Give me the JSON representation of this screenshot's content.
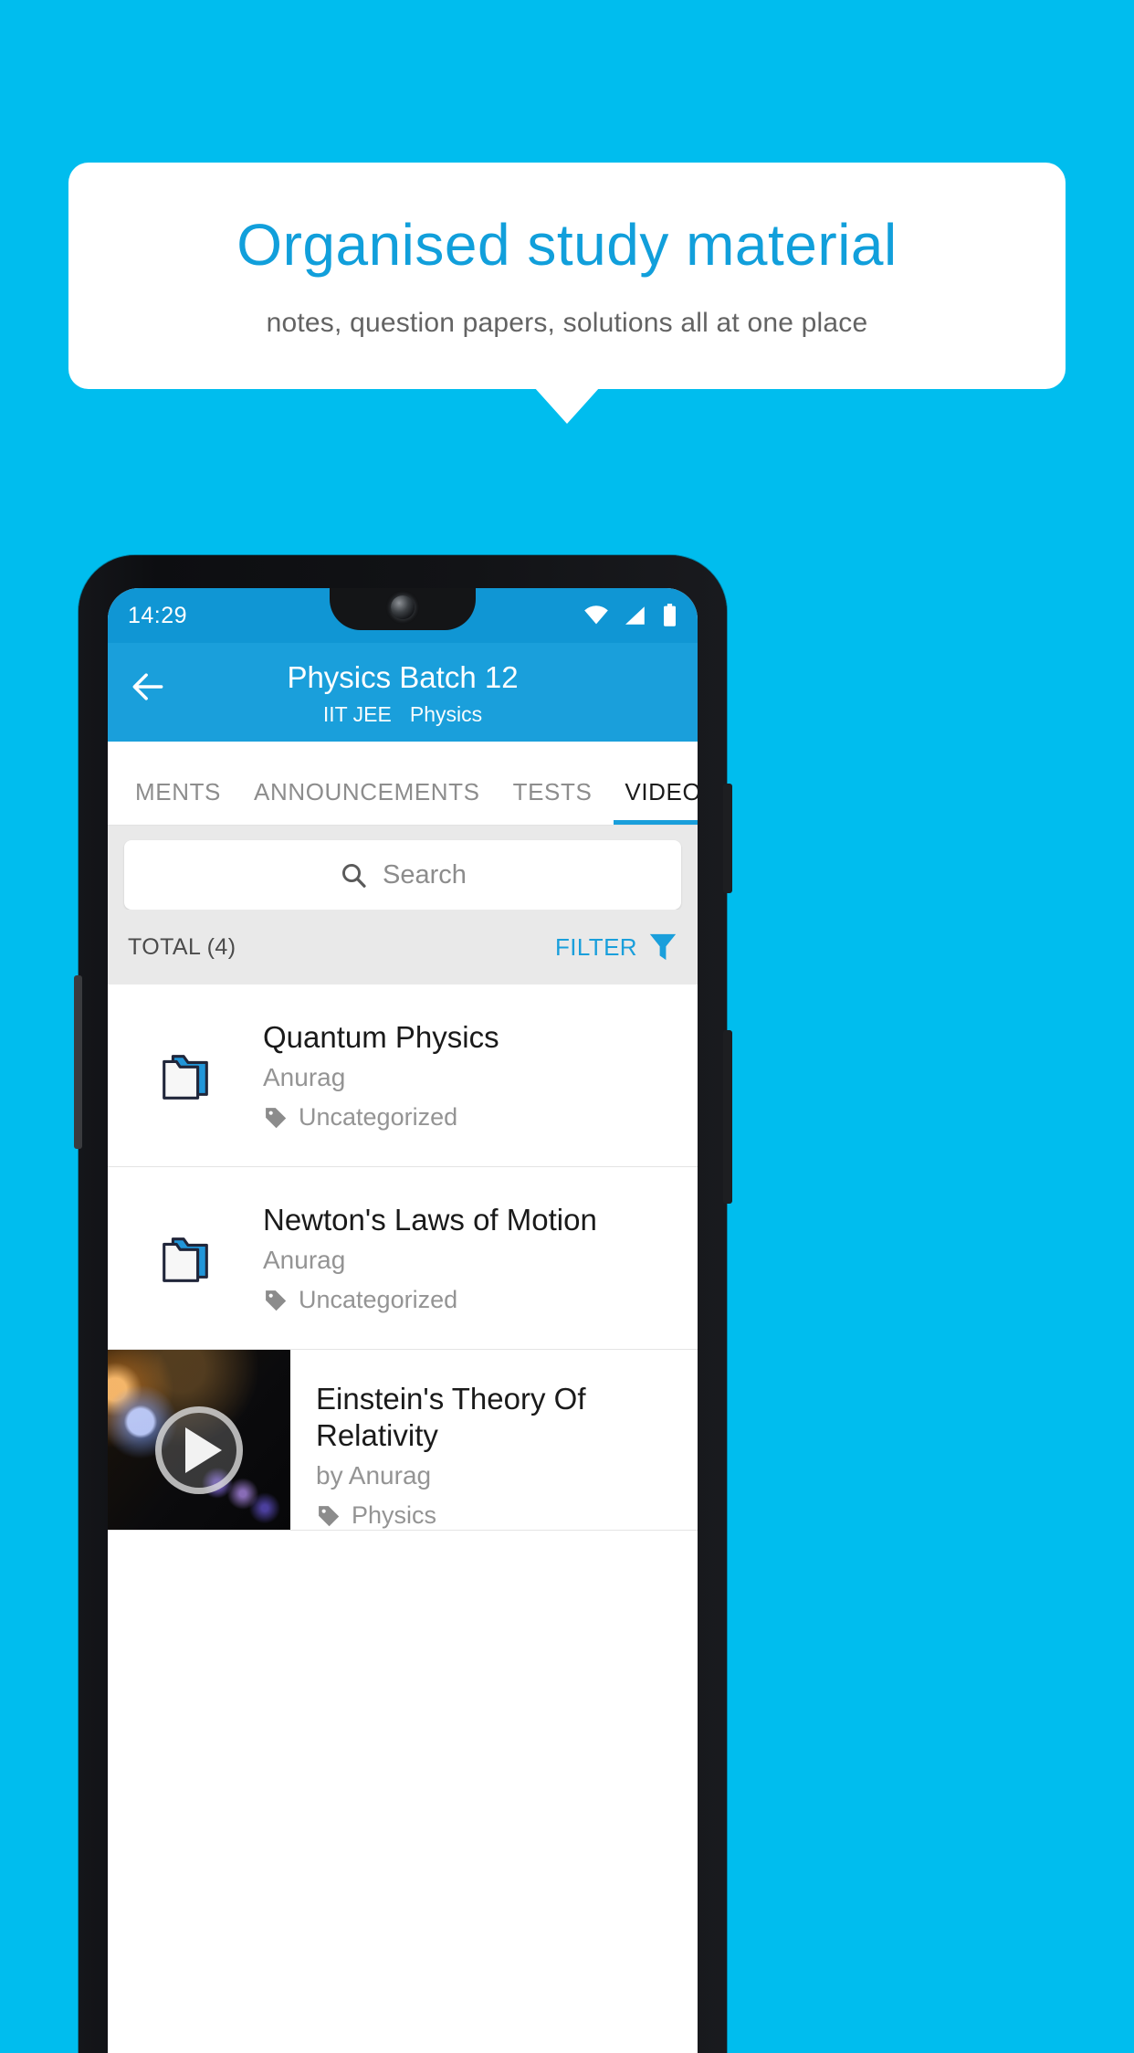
{
  "promo": {
    "title": "Organised study material",
    "subtitle": "notes, question papers, solutions all at one place",
    "title_color": "#119fdb",
    "background_color": "#00bdee"
  },
  "device": {
    "status_bar": {
      "time": "14:29",
      "icons": [
        "wifi-icon",
        "signal-icon",
        "battery-icon"
      ],
      "background_color": "#1096d4"
    }
  },
  "appbar": {
    "back_icon": "back-arrow-icon",
    "title": "Physics Batch 12",
    "subtitle_exam": "IIT JEE",
    "subtitle_subject": "Physics",
    "background_color": "#1a9fdb"
  },
  "tabs": [
    {
      "label": "MENTS",
      "active": false
    },
    {
      "label": "ANNOUNCEMENTS",
      "active": false
    },
    {
      "label": "TESTS",
      "active": false
    },
    {
      "label": "VIDEOS",
      "active": true
    }
  ],
  "search": {
    "placeholder": "Search",
    "icon": "search-icon"
  },
  "toolbar": {
    "total_label": "TOTAL (4)",
    "filter_label": "FILTER",
    "filter_icon": "filter-funnel-icon",
    "filter_color": "#1a9fdb"
  },
  "list": {
    "items": [
      {
        "type": "folder",
        "icon": "folder-icon",
        "title": "Quantum Physics",
        "author": "Anurag",
        "tag_icon": "tag-icon",
        "tag": "Uncategorized"
      },
      {
        "type": "folder",
        "icon": "folder-icon",
        "title": "Newton's Laws of Motion",
        "author": "Anurag",
        "tag_icon": "tag-icon",
        "tag": "Uncategorized"
      },
      {
        "type": "video",
        "icon": "video-thumbnail",
        "play_icon": "play-icon",
        "title": "Einstein's Theory Of Relativity",
        "author": "by Anurag",
        "tag_icon": "tag-icon",
        "tag": "Physics"
      }
    ]
  }
}
